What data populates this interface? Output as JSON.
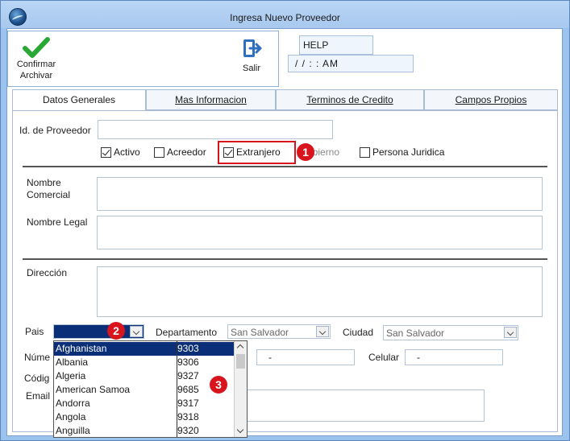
{
  "window": {
    "title": "Ingresa Nuevo Proveedor"
  },
  "toolbar": {
    "confirm_line1": "Confirmar",
    "confirm_line2": "Archivar",
    "exit_label": "Salir",
    "help_text": "HELP",
    "date_text": "/ /    : :  AM"
  },
  "tabs": [
    {
      "label": "Datos Generales"
    },
    {
      "label": "Mas Informacion"
    },
    {
      "label": "Terminos de Credito"
    },
    {
      "label": "Campos Propios"
    }
  ],
  "form": {
    "id_label": "Id. de Proveedor",
    "checkboxes": {
      "activo": "Activo",
      "acreedor": "Acreedor",
      "extranjero": "Extranjero",
      "gobierno": "Gobierno",
      "gobierno_visible": "obierno",
      "persona_juridica": "Persona Juridica"
    },
    "nombre_comercial_l1": "Nombre",
    "nombre_comercial_l2": "Comercial",
    "nombre_legal": "Nombre Legal",
    "direccion": "Dirección",
    "pais": "Pais",
    "departamento": "Departamento",
    "departamento_value": "San Salvador",
    "ciudad": "Ciudad",
    "ciudad_value": "San Salvador",
    "numero_partial": "Núme",
    "codigo_partial": "Códig",
    "email_partial": "Email",
    "telefono_value": "-",
    "celular": "Celular",
    "celular_value": "-"
  },
  "country_dropdown": {
    "items": [
      {
        "name": "Afghanistan",
        "code": "9303"
      },
      {
        "name": "Albania",
        "code": "9306"
      },
      {
        "name": "Algeria",
        "code": "9327"
      },
      {
        "name": "American Samoa",
        "code": "9685"
      },
      {
        "name": "Andorra",
        "code": "9317"
      },
      {
        "name": "Angola",
        "code": "9318"
      },
      {
        "name": "Anguilla",
        "code": "9320"
      }
    ],
    "selected_index": 0
  },
  "annotations": [
    "1",
    "2",
    "3"
  ],
  "colors": {
    "accent_red": "#d8141c",
    "selection": "#0a2f78",
    "frame": "#9cc2ee"
  }
}
